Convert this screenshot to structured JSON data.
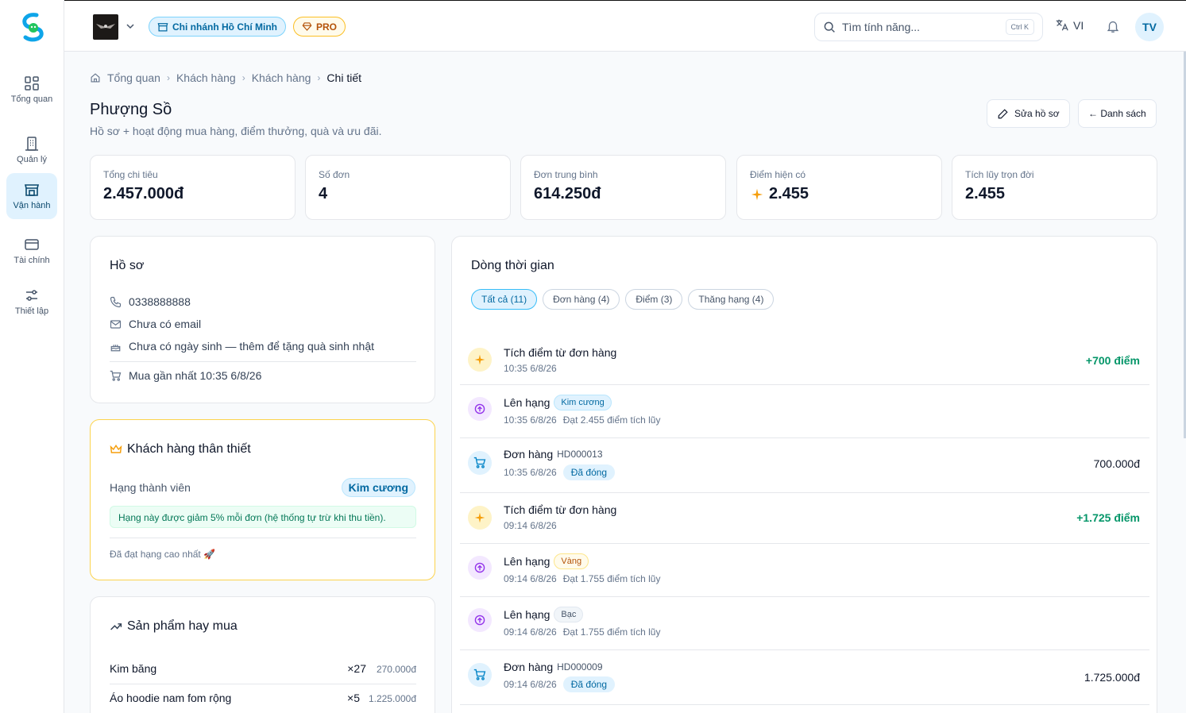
{
  "nav": {
    "items": [
      {
        "label": "Tổng quan",
        "icon": "grid-icon"
      },
      {
        "label": "Quản lý",
        "icon": "building-icon"
      },
      {
        "label": "Vận hành",
        "icon": "store-icon"
      },
      {
        "label": "Tài chính",
        "icon": "card-icon"
      },
      {
        "label": "Thiết lập",
        "icon": "sliders-icon"
      }
    ],
    "active": "Vận hành"
  },
  "topbar": {
    "branch": "Chi nhánh Hồ Chí Minh",
    "plan": "PRO",
    "search_placeholder": "Tìm tính năng...",
    "shortcut": "Ctrl K",
    "language": "VI",
    "avatar": "TV"
  },
  "breadcrumb": [
    "Tổng quan",
    "Khách hàng",
    "Khách hàng",
    "Chi tiết"
  ],
  "page": {
    "title": "Phượng Sồ",
    "subtitle": "Hồ sơ + hoạt động mua hàng, điểm thưởng, quà và ưu đãi.",
    "edit_button": "Sửa hồ sơ",
    "back_button": "← Danh sách"
  },
  "stats": [
    {
      "label": "Tổng chi tiêu",
      "value": "2.457.000đ"
    },
    {
      "label": "Số đơn",
      "value": "4"
    },
    {
      "label": "Đơn trung bình",
      "value": "614.250đ"
    },
    {
      "label": "Điểm hiện có",
      "value": "2.455"
    },
    {
      "label": "Tích lũy trọn đời",
      "value": "2.455"
    }
  ],
  "profile": {
    "title": "Hồ sơ",
    "phone": "0338888888",
    "email": "Chưa có email",
    "birthday": "Chưa có ngày sinh — thêm để tặng quà sinh nhật",
    "last_purchase": "Mua gần nhất 10:35 6/8/26"
  },
  "loyalty": {
    "title": "Khách hàng thân thiết",
    "tier_label": "Hạng thành viên",
    "tier": "Kim cương",
    "discount_note": "Hạng này được giảm 5% mỗi đơn (hệ thống tự trừ khi thu tiền).",
    "max_note": "Đã đạt hạng cao nhất 🚀"
  },
  "products": {
    "title": "Sản phẩm hay mua",
    "items": [
      {
        "name": "Kim băng",
        "qty": "×27",
        "amount": "270.000đ"
      },
      {
        "name": "Áo hoodie nam fom rộng",
        "qty": "×5",
        "amount": "1.225.000đ"
      }
    ]
  },
  "timeline": {
    "title": "Dòng thời gian",
    "tabs": [
      "Tất cả (11)",
      "Đơn hàng (4)",
      "Điểm (3)",
      "Thăng hạng (4)"
    ],
    "items": [
      {
        "kind": "points",
        "title": "Tích điểm từ đơn hàng",
        "time": "10:35 6/8/26",
        "amount": "+700 điểm"
      },
      {
        "kind": "tier",
        "title": "Lên hạng",
        "badge": "Kim cương",
        "badge_class": "b-diamond",
        "time": "10:35 6/8/26",
        "note": "Đạt 2.455 điểm tích lũy"
      },
      {
        "kind": "order",
        "title": "Đơn hàng",
        "code": "HD000013",
        "time": "10:35 6/8/26",
        "status": "Đã đóng",
        "amount": "700.000đ"
      },
      {
        "kind": "points",
        "title": "Tích điểm từ đơn hàng",
        "time": "09:14 6/8/26",
        "amount": "+1.725 điểm"
      },
      {
        "kind": "tier",
        "title": "Lên hạng",
        "badge": "Vàng",
        "badge_class": "b-gold",
        "time": "09:14 6/8/26",
        "note": "Đạt 1.755 điểm tích lũy"
      },
      {
        "kind": "tier",
        "title": "Lên hạng",
        "badge": "Bạc",
        "badge_class": "b-silver",
        "time": "09:14 6/8/26",
        "note": "Đạt 1.755 điểm tích lũy"
      },
      {
        "kind": "order",
        "title": "Đơn hàng",
        "code": "HD000009",
        "time": "09:14 6/8/26",
        "status": "Đã đóng",
        "amount": "1.725.000đ"
      }
    ]
  },
  "colors": {
    "accent": "#0284c7",
    "points_green": "#059669",
    "gold": "#f59e0b",
    "tier_purple": "#9333ea"
  }
}
